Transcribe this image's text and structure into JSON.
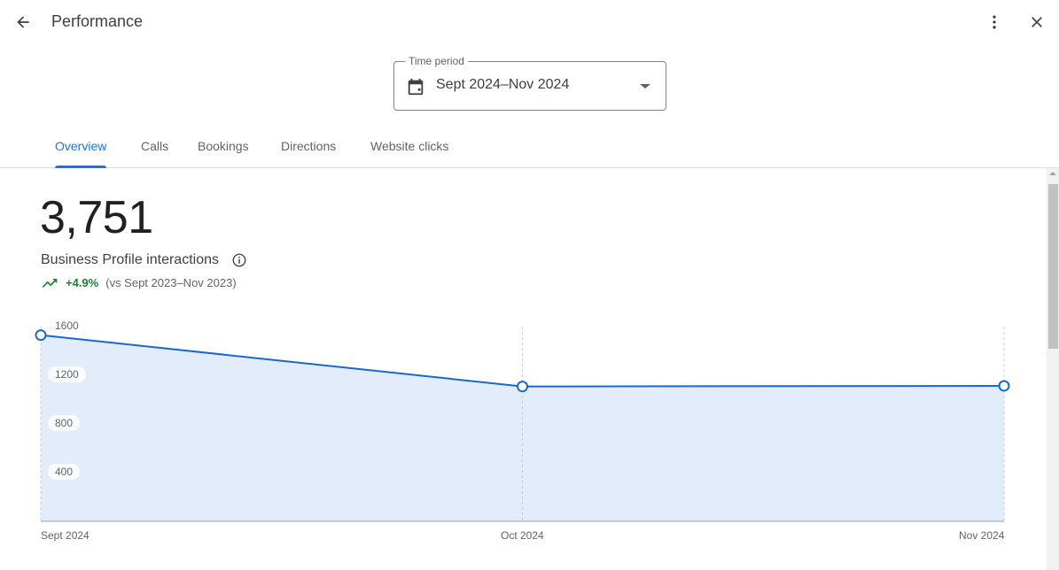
{
  "header": {
    "title": "Performance",
    "back_icon": "arrow-back-icon",
    "more_icon": "more-vert-icon",
    "close_icon": "close-icon"
  },
  "time_period": {
    "label": "Time period",
    "value": "Sept 2024–Nov 2024",
    "icon": "calendar-icon"
  },
  "tabs": [
    {
      "label": "Overview",
      "active": true
    },
    {
      "label": "Calls",
      "active": false
    },
    {
      "label": "Bookings",
      "active": false
    },
    {
      "label": "Directions",
      "active": false
    },
    {
      "label": "Website clicks",
      "active": false
    }
  ],
  "summary": {
    "total": "3,751",
    "metric_label": "Business Profile interactions",
    "change": "+4.9%",
    "comparison": "(vs Sept 2023–Nov 2023)",
    "trend_color": "#188038"
  },
  "colors": {
    "accent": "#1a73e8",
    "line": "#1967d2",
    "area": "#e3ecfb"
  },
  "chart_data": {
    "type": "area",
    "title": "",
    "xlabel": "",
    "ylabel": "",
    "categories": [
      "Sept 2024",
      "Oct 2024",
      "Nov 2024"
    ],
    "series": [
      {
        "name": "Business Profile interactions",
        "values": [
          1530,
          1108,
          1113
        ]
      }
    ],
    "y_ticks": [
      400,
      800,
      1200,
      1600
    ],
    "ylim": [
      0,
      1600
    ],
    "grid": "vertical dashed at each category",
    "legend": "none"
  }
}
